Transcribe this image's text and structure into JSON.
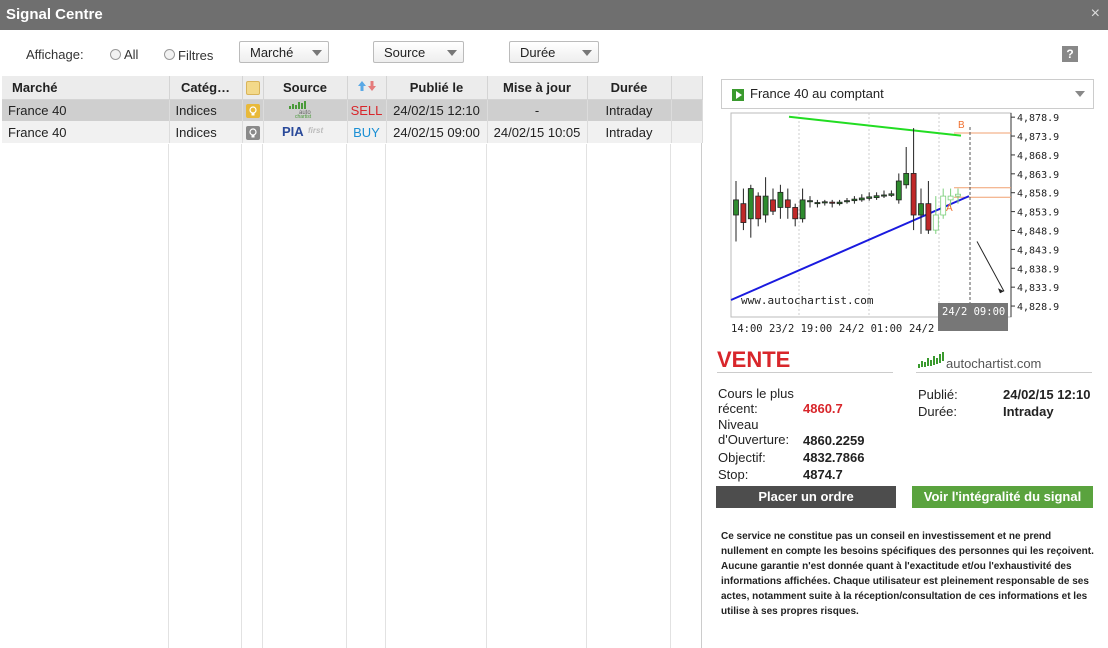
{
  "window": {
    "title": "Signal Centre",
    "close_glyph": "×"
  },
  "filters": {
    "label": "Affichage:",
    "radio_all": "All",
    "radio_filters": "Filtres",
    "marche": "Marché",
    "source": "Source",
    "duree": "Durée",
    "help": "?"
  },
  "table": {
    "headers": {
      "marche": "Marché",
      "categorie": "Catég…",
      "source": "Source",
      "publie": "Publié le",
      "mise": "Mise à jour",
      "duree": "Durée"
    },
    "rows": [
      {
        "marche": "France 40",
        "categorie": "Indices",
        "source": "autochartist",
        "signal": "SELL",
        "publie": "24/02/15 12:10",
        "mise": "-",
        "duree": "Intraday",
        "bulb_color": "#e8b93a"
      },
      {
        "marche": "France 40",
        "categorie": "Indices",
        "source": "PIA first",
        "signal": "BUY",
        "publie": "24/02/15 09:00",
        "mise": "24/02/15 10:05",
        "duree": "Intraday",
        "bulb_color": "#8a8a8a"
      }
    ]
  },
  "detail": {
    "instrument": "France 40 au comptant",
    "direction": "VENTE",
    "logo_text": "autochartist.com",
    "recent_label": "Cours le plus récent:",
    "recent_value": "4860.7",
    "ouverture_label": "Niveau d'Ouverture:",
    "ouverture_value": "4860.2259",
    "objectif_label": "Objectif:",
    "objectif_value": "4832.7866",
    "stop_label": "Stop:",
    "stop_value": "4874.7",
    "publie_label": "Publié:",
    "publie_value": "24/02/15 12:10",
    "duree_label": "Durée:",
    "duree_value": "Intraday",
    "btn_order": "Placer un ordre",
    "btn_signal": "Voir l'intégralité du signal",
    "disclaimer": "Ce service ne constitue pas un conseil en investissement et ne prend nullement en compte les besoins spécifiques des personnes qui les reçoivent. Aucune garantie n'est donnée quant à l'exactitude et/ou l'exhaustivité des informations affichées. Chaque utilisateur est pleinement responsable de ses actes, notamment suite à la réception/consultation de ces informations et les utilise à ses propres risques."
  },
  "chart_data": {
    "type": "candlestick",
    "y_ticks": [
      "4,878.9",
      "4,873.9",
      "4,868.9",
      "4,863.9",
      "4,858.9",
      "4,853.9",
      "4,848.9",
      "4,843.9",
      "4,838.9",
      "4,833.9",
      "4,828.9"
    ],
    "x_ticks": [
      "14:00",
      "23/2 19:00",
      "24/2 01:00",
      "24/2",
      "24/2 09:00"
    ],
    "watermark": "www.autochartist.com",
    "markers": [
      "A",
      "B"
    ],
    "candles": [
      {
        "o": 4853,
        "c": 4857,
        "h": 4862,
        "l": 4846
      },
      {
        "o": 4856,
        "c": 4851,
        "h": 4860,
        "l": 4849
      },
      {
        "o": 4852,
        "c": 4860,
        "h": 4861,
        "l": 4847
      },
      {
        "o": 4858,
        "c": 4852,
        "h": 4859,
        "l": 4850
      },
      {
        "o": 4853,
        "c": 4858,
        "h": 4863,
        "l": 4851
      },
      {
        "o": 4857,
        "c": 4854,
        "h": 4860,
        "l": 4853
      },
      {
        "o": 4855,
        "c": 4859,
        "h": 4861,
        "l": 4852
      },
      {
        "o": 4857,
        "c": 4855,
        "h": 4860,
        "l": 4852
      },
      {
        "o": 4855,
        "c": 4852,
        "h": 4856,
        "l": 4850
      },
      {
        "o": 4852,
        "c": 4857,
        "h": 4860,
        "l": 4851
      },
      {
        "o": 4856.5,
        "c": 4856.8,
        "h": 4858,
        "l": 4855
      },
      {
        "o": 4856,
        "c": 4856.3,
        "h": 4857,
        "l": 4855
      },
      {
        "o": 4856.2,
        "c": 4856.5,
        "h": 4857,
        "l": 4855.5
      },
      {
        "o": 4856.4,
        "c": 4856.1,
        "h": 4857,
        "l": 4855
      },
      {
        "o": 4856,
        "c": 4856.4,
        "h": 4857,
        "l": 4855.5
      },
      {
        "o": 4856.5,
        "c": 4856.8,
        "h": 4857.5,
        "l": 4856
      },
      {
        "o": 4856.8,
        "c": 4857.2,
        "h": 4858,
        "l": 4856
      },
      {
        "o": 4857,
        "c": 4857.5,
        "h": 4858.5,
        "l": 4856.5
      },
      {
        "o": 4857.4,
        "c": 4857.8,
        "h": 4859,
        "l": 4856.8
      },
      {
        "o": 4857.6,
        "c": 4858.1,
        "h": 4859,
        "l": 4857
      },
      {
        "o": 4858,
        "c": 4858.3,
        "h": 4859.5,
        "l": 4857.5
      },
      {
        "o": 4858.2,
        "c": 4858.6,
        "h": 4859.5,
        "l": 4857.8
      },
      {
        "o": 4857,
        "c": 4862,
        "h": 4864,
        "l": 4856
      },
      {
        "o": 4861,
        "c": 4864,
        "h": 4871,
        "l": 4860
      },
      {
        "o": 4864,
        "c": 4853,
        "h": 4876,
        "l": 4849
      },
      {
        "o": 4853,
        "c": 4856,
        "h": 4860,
        "l": 4848
      },
      {
        "o": 4856,
        "c": 4849,
        "h": 4862,
        "l": 4848
      },
      {
        "o": 4849,
        "c": 4853,
        "h": 4858,
        "l": 4848
      },
      {
        "o": 4853,
        "c": 4858,
        "h": 4860,
        "l": 4852
      },
      {
        "o": 4857,
        "c": 4858,
        "h": 4860,
        "l": 4855
      },
      {
        "o": 4858,
        "c": 4858.5,
        "h": 4860,
        "l": 4856
      }
    ],
    "resistance_line": {
      "from": 4879,
      "to": 4874
    },
    "support_line": {
      "from": 4830.5,
      "to": 4858
    },
    "target": 4832.8,
    "stop": 4874.7,
    "entry": 4860.2,
    "ylim": [
      4826,
      4880
    ]
  }
}
